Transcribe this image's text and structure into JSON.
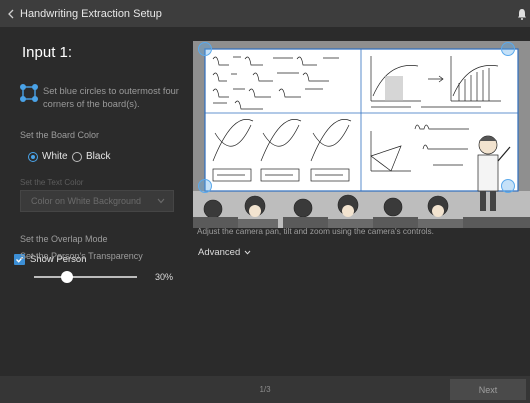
{
  "window": {
    "title": "Handwriting Extraction Setup"
  },
  "left_panel": {
    "input_title": "Input 1:",
    "hint": "Set blue circles to outermost four corners of the board(s).",
    "board_color": {
      "label": "Set the Board Color",
      "options": [
        "White",
        "Black"
      ],
      "selected": "White"
    },
    "text_color": {
      "label": "Set the Text Color",
      "selected": "Color on White Background"
    },
    "overlap": {
      "label": "Set the Overlap Mode",
      "show_person_label": "Show Person",
      "show_person_checked": true
    },
    "transparency": {
      "label": "Set the Person's Transparency",
      "value_text": "30%",
      "value": 0.3
    }
  },
  "main": {
    "instruction": "Adjust the camera pan, tilt and zoom using the camera's controls.",
    "advanced_label": "Advanced"
  },
  "footer": {
    "page_indicator": "1/3",
    "next_label": "Next"
  },
  "colors": {
    "accent": "#4aa3e8",
    "corner_handle": "#5aa9ec",
    "background": "#2b2b2b"
  }
}
